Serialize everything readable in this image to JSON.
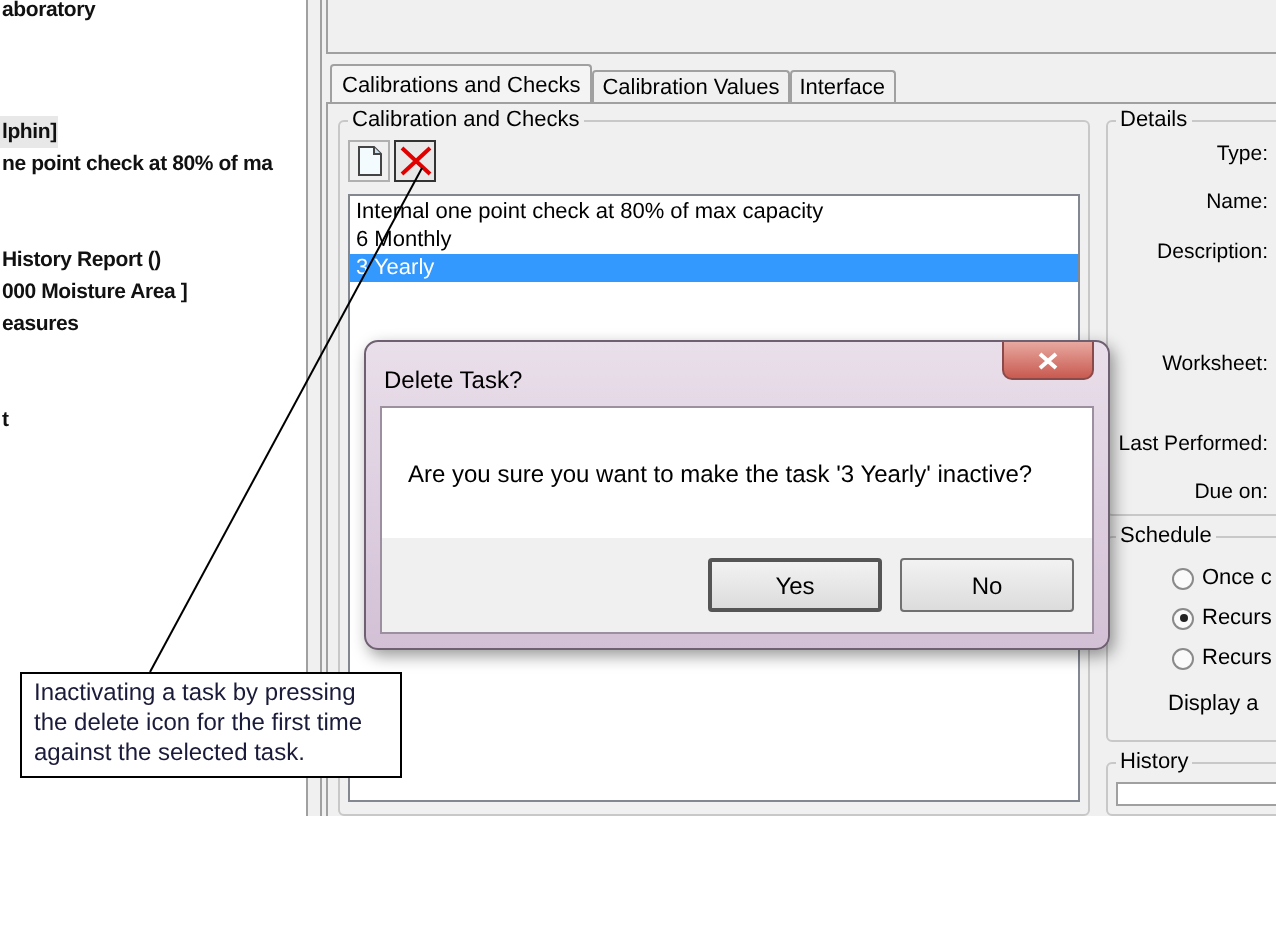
{
  "tree": {
    "items": [
      {
        "label": "aboratory",
        "selected": false
      },
      {
        "label": "lphin]",
        "selected": true
      },
      {
        "label": "ne point check at 80% of ma",
        "selected": false
      },
      {
        "label": "History Report ()",
        "selected": false
      },
      {
        "label": "000 Moisture Area ]",
        "selected": false
      },
      {
        "label": "easures",
        "selected": false
      },
      {
        "label": "t",
        "selected": false
      }
    ]
  },
  "tabs": [
    {
      "label": "Calibrations and Checks",
      "selected": true
    },
    {
      "label": "Calibration Values",
      "selected": false
    },
    {
      "label": "Interface",
      "selected": false
    }
  ],
  "calibration_group": {
    "legend": "Calibration and Checks",
    "toolbar": [
      {
        "kind": "new",
        "pressed": false
      },
      {
        "kind": "delete",
        "pressed": true
      }
    ],
    "tasks": [
      {
        "label": "Internal one point check at 80% of max capacity",
        "selected": false
      },
      {
        "label": "6 Monthly",
        "selected": false
      },
      {
        "label": "3 Yearly",
        "selected": true
      }
    ]
  },
  "details": {
    "legend": "Details",
    "fields": [
      "Type:",
      "Name:",
      "Description:",
      "Worksheet:",
      "Last Performed:",
      "Due on:"
    ]
  },
  "schedule": {
    "legend": "Schedule",
    "options": [
      {
        "label": "Once c",
        "selected": false
      },
      {
        "label": "Recurs",
        "selected": true
      },
      {
        "label": "Recurs",
        "selected": false
      }
    ],
    "note": "Display a"
  },
  "history": {
    "legend": "History"
  },
  "dialog": {
    "title": "Delete Task?",
    "message": "Are you sure you want to make the task '3 Yearly' inactive?",
    "buttons": [
      "Yes",
      "No"
    ]
  },
  "callout": {
    "text": "Inactivating a task by pressing the delete icon for the first time against the selected task."
  }
}
